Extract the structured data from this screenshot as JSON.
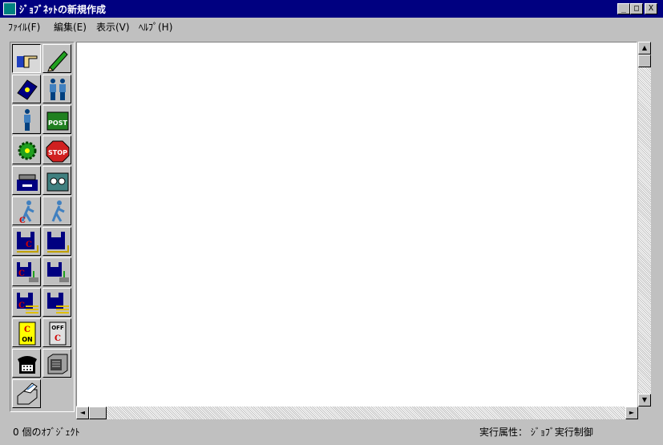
{
  "window": {
    "title": "ｼﾞｮﾌﾞﾈｯﾄの新規作成",
    "minimize": "_",
    "maximize": "□",
    "close": "X"
  },
  "menu": {
    "file": "ﾌｧｲﾙ(F)",
    "edit": "編集(E)",
    "view": "表示(V)",
    "help": "ﾍﾙﾌﾟ(H)"
  },
  "toolbar": {
    "post_label": "POST",
    "stop_label": "STOP",
    "on_label": "ON",
    "off_label": "OFF",
    "c_label": "C"
  },
  "scroll": {
    "up": "▲",
    "down": "▼",
    "left": "◄",
    "right": "►"
  },
  "status": {
    "object_count": "0 個のｵﾌﾞｼﾞｪｸﾄ",
    "exec_attr": "実行属性： ｼﾞｮﾌﾞ実行制御"
  }
}
